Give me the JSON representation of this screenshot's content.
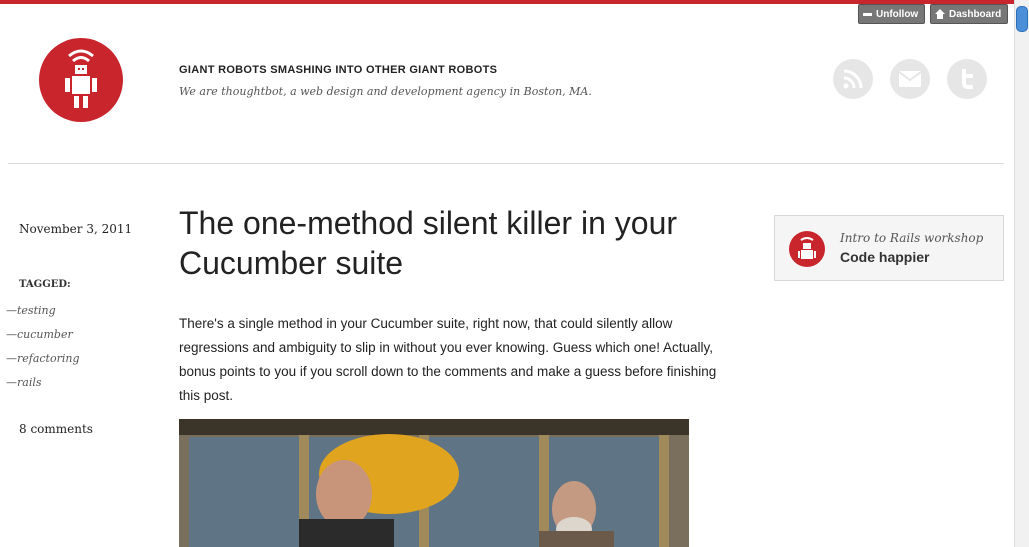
{
  "site": {
    "title": "GIANT ROBOTS SMASHING INTO OTHER GIANT ROBOTS",
    "tagline": "We are thoughtbot, a web design and development agency in Boston, MA."
  },
  "tumblr_controls": {
    "unfollow": "Unfollow",
    "dashboard": "Dashboard"
  },
  "social_icons": [
    "rss-icon",
    "mail-icon",
    "twitter-icon"
  ],
  "post": {
    "date": "November 3, 2011",
    "tagged_label": "TAGGED:",
    "tags": [
      "—testing",
      "—cucumber",
      "—refactoring",
      "—rails"
    ],
    "comments": "8 comments",
    "title": "The one-method silent killer in your Cucumber suite",
    "body": "There's a single method in your Cucumber suite, right now, that could silently allow regressions and ambiguity to slip in without you ever knowing. Guess which one! Actually, bonus points to you if you scroll down to the comments and make a guess before finishing this post."
  },
  "promo": {
    "title": "Intro to Rails workshop",
    "subtitle": "Code happier"
  },
  "colors": {
    "brand_red": "#c8252c",
    "social_gray": "#e6e6e6"
  }
}
